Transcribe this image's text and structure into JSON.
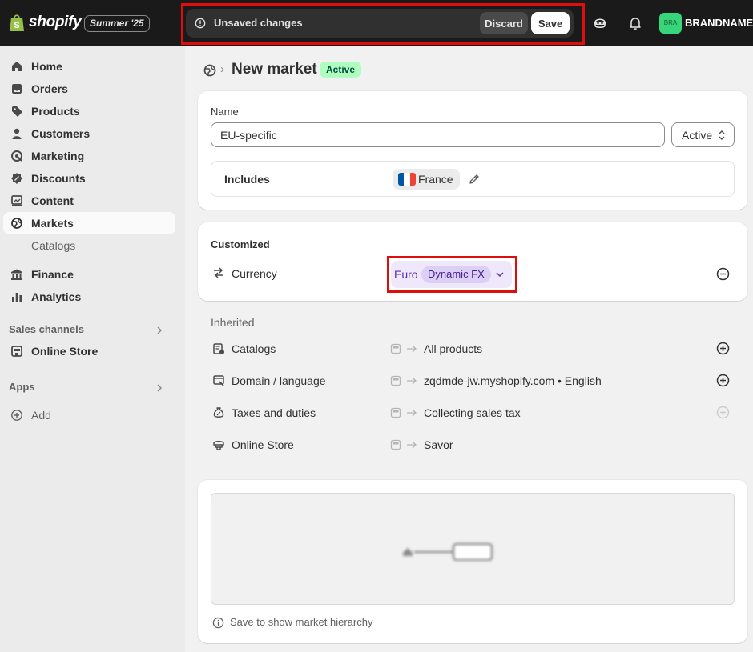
{
  "topbar": {
    "brand_logo": "shopify",
    "edition_badge": "Summer '25",
    "unsaved_message": "Unsaved changes",
    "discard_label": "Discard",
    "save_label": "Save",
    "avatar_initials": "BRA",
    "store_name": "BRANDNAME",
    "icons": [
      "info-icon",
      "sidekick-icon",
      "bell-icon"
    ]
  },
  "sidebar": {
    "items": [
      {
        "label": "Home",
        "icon": "home-icon"
      },
      {
        "label": "Orders",
        "icon": "inbox-icon"
      },
      {
        "label": "Products",
        "icon": "tag-icon"
      },
      {
        "label": "Customers",
        "icon": "person-icon"
      },
      {
        "label": "Marketing",
        "icon": "target-icon"
      },
      {
        "label": "Discounts",
        "icon": "discount-icon"
      },
      {
        "label": "Content",
        "icon": "image-icon"
      },
      {
        "label": "Markets",
        "icon": "globe-icon"
      },
      {
        "label": "Catalogs",
        "icon": ""
      },
      {
        "label": "Finance",
        "icon": "bank-icon"
      },
      {
        "label": "Analytics",
        "icon": "bar-chart-icon"
      }
    ],
    "sales_channels_label": "Sales channels",
    "online_store_label": "Online Store",
    "apps_label": "Apps",
    "add_label": "Add"
  },
  "page": {
    "title": "New market",
    "status_badge": "Active"
  },
  "details": {
    "name_label": "Name",
    "name_value": "EU-specific",
    "status_value": "Active",
    "includes_label": "Includes",
    "country": "France"
  },
  "customized": {
    "title": "Customized",
    "currency_label": "Currency",
    "currency_value": "Euro",
    "fx_label": "Dynamic FX"
  },
  "inherited": {
    "title": "Inherited",
    "rows": [
      {
        "label": "Catalogs",
        "value": "All products",
        "icon": "catalog-icon"
      },
      {
        "label": "Domain / language",
        "value": "zqdmde-jw.myshopify.com • English",
        "icon": "domain-icon"
      },
      {
        "label": "Taxes and duties",
        "value": "Collecting sales tax",
        "icon": "tax-icon"
      },
      {
        "label": "Online Store",
        "value": "Savor",
        "icon": "theme-icon"
      }
    ]
  },
  "hierarchy": {
    "note": "Save to show market hierarchy"
  },
  "colors": {
    "topbar": "#1a1a1a",
    "highlight": "#e00d0d",
    "badge_green": "#affebf",
    "currency_purple": "#5e2bb0"
  }
}
